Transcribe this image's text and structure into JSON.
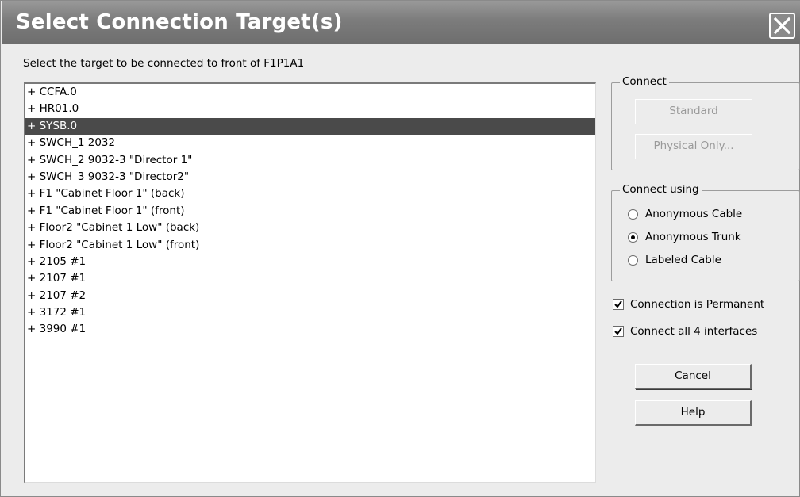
{
  "window": {
    "title": "Select Connection Target(s)"
  },
  "instruction": "Select the target to be connected to front of F1P1A1",
  "targets": [
    {
      "label": "+ CCFA.0",
      "selected": false
    },
    {
      "label": "+ HR01.0",
      "selected": false
    },
    {
      "label": "+ SYSB.0",
      "selected": true
    },
    {
      "label": "+ SWCH_1 2032",
      "selected": false
    },
    {
      "label": "+ SWCH_2 9032-3 \"Director 1\"",
      "selected": false
    },
    {
      "label": "+ SWCH_3 9032-3 \"Director2\"",
      "selected": false
    },
    {
      "label": "+ F1 \"Cabinet Floor 1\" (back)",
      "selected": false
    },
    {
      "label": "+ F1 \"Cabinet Floor 1\" (front)",
      "selected": false
    },
    {
      "label": "+ Floor2 \"Cabinet 1 Low\" (back)",
      "selected": false
    },
    {
      "label": "+ Floor2 \"Cabinet 1 Low\" (front)",
      "selected": false
    },
    {
      "label": "+ 2105 #1",
      "selected": false
    },
    {
      "label": "+ 2107 #1",
      "selected": false
    },
    {
      "label": "+ 2107 #2",
      "selected": false
    },
    {
      "label": "+ 3172 #1",
      "selected": false
    },
    {
      "label": "+ 3990 #1",
      "selected": false
    }
  ],
  "connect_group": {
    "label": "Connect",
    "standard_label": "Standard",
    "physical_only_label": "Physical Only..."
  },
  "connect_using_group": {
    "label": "Connect using",
    "options": [
      {
        "label": "Anonymous Cable",
        "checked": false
      },
      {
        "label": "Anonymous Trunk",
        "checked": true
      },
      {
        "label": "Labeled Cable",
        "checked": false
      }
    ]
  },
  "checkboxes": {
    "permanent_label": "Connection is Permanent",
    "permanent_checked": true,
    "all_interfaces_label": "Connect all 4 interfaces",
    "all_interfaces_checked": true
  },
  "buttons": {
    "cancel_label": "Cancel",
    "help_label": "Help"
  },
  "colors": {
    "titlebar": "#7c7c7c",
    "selection": "#4a4a4a",
    "dialog_bg": "#ececec"
  }
}
